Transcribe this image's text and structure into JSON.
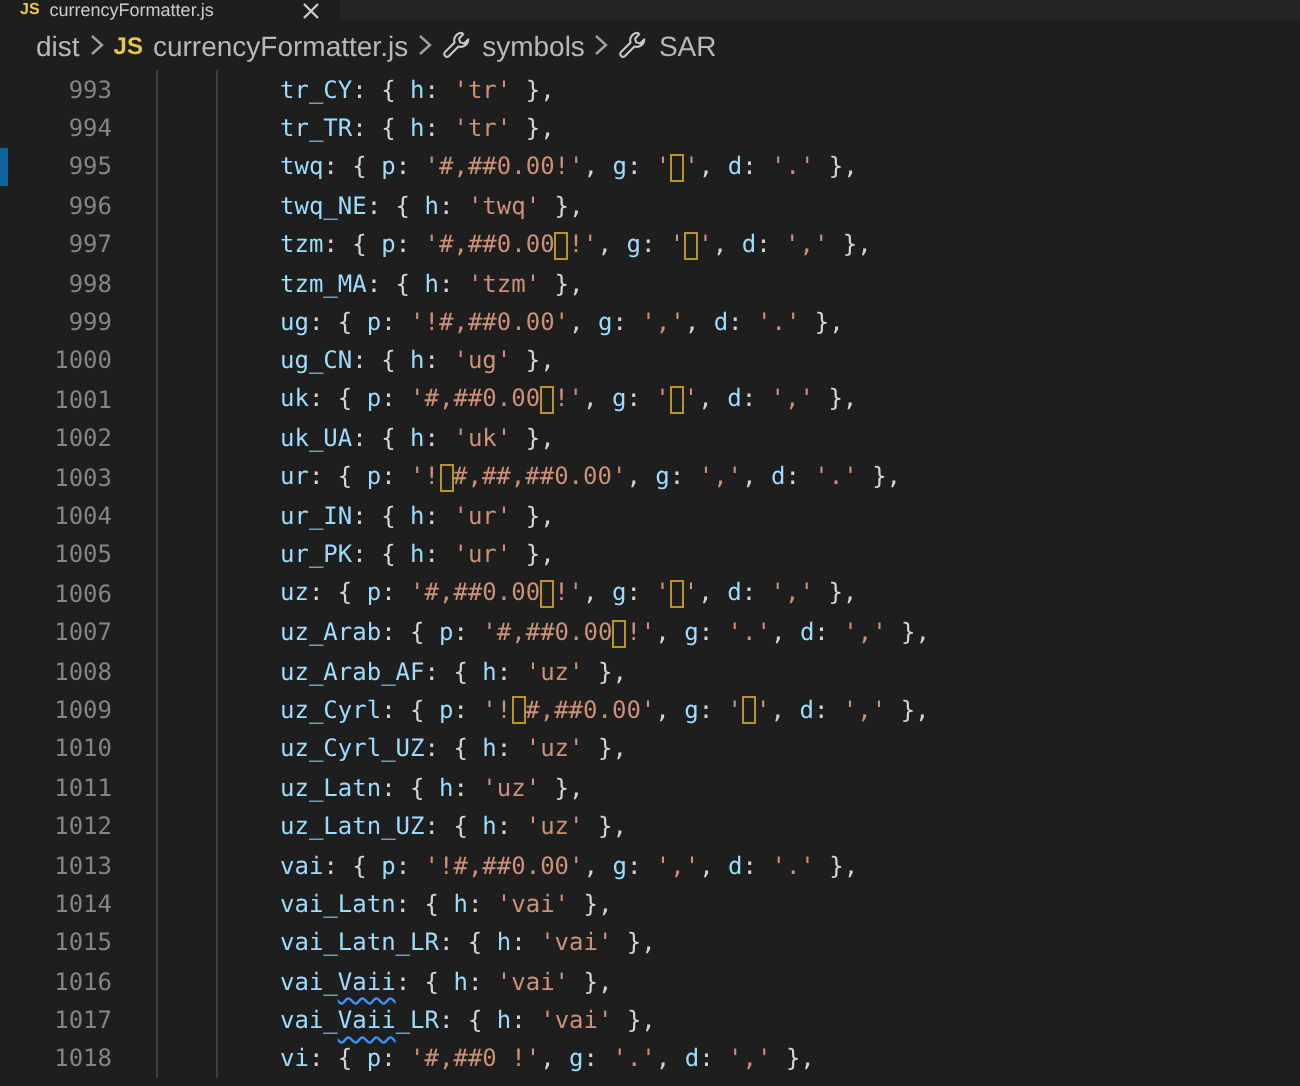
{
  "tab": {
    "badge": "JS",
    "title": "currencyFormatter.js"
  },
  "breadcrumb": [
    {
      "kind": "folder",
      "label": "dist"
    },
    {
      "kind": "file",
      "badge": "JS",
      "label": "currencyFormatter.js"
    },
    {
      "kind": "symbol",
      "label": "symbols"
    },
    {
      "kind": "symbol",
      "label": "SAR"
    }
  ],
  "lines": [
    {
      "number": "993",
      "marked": false,
      "tokens": [
        {
          "kind": "key",
          "text": "tr_CY"
        },
        {
          "kind": "punct",
          "text": ": { "
        },
        {
          "kind": "key",
          "text": "h"
        },
        {
          "kind": "punct",
          "text": ": "
        },
        {
          "kind": "str",
          "text": "'tr'"
        },
        {
          "kind": "punct",
          "text": " },"
        }
      ]
    },
    {
      "number": "994",
      "marked": false,
      "tokens": [
        {
          "kind": "key",
          "text": "tr_TR"
        },
        {
          "kind": "punct",
          "text": ": { "
        },
        {
          "kind": "key",
          "text": "h"
        },
        {
          "kind": "punct",
          "text": ": "
        },
        {
          "kind": "str",
          "text": "'tr'"
        },
        {
          "kind": "punct",
          "text": " },"
        }
      ]
    },
    {
      "number": "995",
      "marked": true,
      "tokens": [
        {
          "kind": "key",
          "text": "twq"
        },
        {
          "kind": "punct",
          "text": ": { "
        },
        {
          "kind": "key",
          "text": "p"
        },
        {
          "kind": "punct",
          "text": ": "
        },
        {
          "kind": "str",
          "text": "'#,##0.00!'"
        },
        {
          "kind": "punct",
          "text": ", "
        },
        {
          "kind": "key",
          "text": "g"
        },
        {
          "kind": "punct",
          "text": ": "
        },
        {
          "kind": "str",
          "text": "'"
        },
        {
          "kind": "box"
        },
        {
          "kind": "str",
          "text": "'"
        },
        {
          "kind": "punct",
          "text": ", "
        },
        {
          "kind": "key",
          "text": "d"
        },
        {
          "kind": "punct",
          "text": ": "
        },
        {
          "kind": "str",
          "text": "'.'"
        },
        {
          "kind": "punct",
          "text": " },"
        }
      ]
    },
    {
      "number": "996",
      "marked": false,
      "tokens": [
        {
          "kind": "key",
          "text": "twq_NE"
        },
        {
          "kind": "punct",
          "text": ": { "
        },
        {
          "kind": "key",
          "text": "h"
        },
        {
          "kind": "punct",
          "text": ": "
        },
        {
          "kind": "str",
          "text": "'twq'"
        },
        {
          "kind": "punct",
          "text": " },"
        }
      ]
    },
    {
      "number": "997",
      "marked": false,
      "tokens": [
        {
          "kind": "key",
          "text": "tzm"
        },
        {
          "kind": "punct",
          "text": ": { "
        },
        {
          "kind": "key",
          "text": "p"
        },
        {
          "kind": "punct",
          "text": ": "
        },
        {
          "kind": "str",
          "text": "'#,##0.00"
        },
        {
          "kind": "box"
        },
        {
          "kind": "str",
          "text": "!'"
        },
        {
          "kind": "punct",
          "text": ", "
        },
        {
          "kind": "key",
          "text": "g"
        },
        {
          "kind": "punct",
          "text": ": "
        },
        {
          "kind": "str",
          "text": "'"
        },
        {
          "kind": "box"
        },
        {
          "kind": "str",
          "text": "'"
        },
        {
          "kind": "punct",
          "text": ", "
        },
        {
          "kind": "key",
          "text": "d"
        },
        {
          "kind": "punct",
          "text": ": "
        },
        {
          "kind": "str",
          "text": "','"
        },
        {
          "kind": "punct",
          "text": " },"
        }
      ]
    },
    {
      "number": "998",
      "marked": false,
      "tokens": [
        {
          "kind": "key",
          "text": "tzm_MA"
        },
        {
          "kind": "punct",
          "text": ": { "
        },
        {
          "kind": "key",
          "text": "h"
        },
        {
          "kind": "punct",
          "text": ": "
        },
        {
          "kind": "str",
          "text": "'tzm'"
        },
        {
          "kind": "punct",
          "text": " },"
        }
      ]
    },
    {
      "number": "999",
      "marked": false,
      "tokens": [
        {
          "kind": "key",
          "text": "ug"
        },
        {
          "kind": "punct",
          "text": ": { "
        },
        {
          "kind": "key",
          "text": "p"
        },
        {
          "kind": "punct",
          "text": ": "
        },
        {
          "kind": "str",
          "text": "'!#,##0.00'"
        },
        {
          "kind": "punct",
          "text": ", "
        },
        {
          "kind": "key",
          "text": "g"
        },
        {
          "kind": "punct",
          "text": ": "
        },
        {
          "kind": "str",
          "text": "','"
        },
        {
          "kind": "punct",
          "text": ", "
        },
        {
          "kind": "key",
          "text": "d"
        },
        {
          "kind": "punct",
          "text": ": "
        },
        {
          "kind": "str",
          "text": "'.'"
        },
        {
          "kind": "punct",
          "text": " },"
        }
      ]
    },
    {
      "number": "1000",
      "marked": false,
      "tokens": [
        {
          "kind": "key",
          "text": "ug_CN"
        },
        {
          "kind": "punct",
          "text": ": { "
        },
        {
          "kind": "key",
          "text": "h"
        },
        {
          "kind": "punct",
          "text": ": "
        },
        {
          "kind": "str",
          "text": "'ug'"
        },
        {
          "kind": "punct",
          "text": " },"
        }
      ]
    },
    {
      "number": "1001",
      "marked": false,
      "tokens": [
        {
          "kind": "key",
          "text": "uk"
        },
        {
          "kind": "punct",
          "text": ": { "
        },
        {
          "kind": "key",
          "text": "p"
        },
        {
          "kind": "punct",
          "text": ": "
        },
        {
          "kind": "str",
          "text": "'#,##0.00"
        },
        {
          "kind": "box"
        },
        {
          "kind": "str",
          "text": "!'"
        },
        {
          "kind": "punct",
          "text": ", "
        },
        {
          "kind": "key",
          "text": "g"
        },
        {
          "kind": "punct",
          "text": ": "
        },
        {
          "kind": "str",
          "text": "'"
        },
        {
          "kind": "box"
        },
        {
          "kind": "str",
          "text": "'"
        },
        {
          "kind": "punct",
          "text": ", "
        },
        {
          "kind": "key",
          "text": "d"
        },
        {
          "kind": "punct",
          "text": ": "
        },
        {
          "kind": "str",
          "text": "','"
        },
        {
          "kind": "punct",
          "text": " },"
        }
      ]
    },
    {
      "number": "1002",
      "marked": false,
      "tokens": [
        {
          "kind": "key",
          "text": "uk_UA"
        },
        {
          "kind": "punct",
          "text": ": { "
        },
        {
          "kind": "key",
          "text": "h"
        },
        {
          "kind": "punct",
          "text": ": "
        },
        {
          "kind": "str",
          "text": "'uk'"
        },
        {
          "kind": "punct",
          "text": " },"
        }
      ]
    },
    {
      "number": "1003",
      "marked": false,
      "tokens": [
        {
          "kind": "key",
          "text": "ur"
        },
        {
          "kind": "punct",
          "text": ": { "
        },
        {
          "kind": "key",
          "text": "p"
        },
        {
          "kind": "punct",
          "text": ": "
        },
        {
          "kind": "str",
          "text": "'!"
        },
        {
          "kind": "box"
        },
        {
          "kind": "str",
          "text": "#,##,##0.00'"
        },
        {
          "kind": "punct",
          "text": ", "
        },
        {
          "kind": "key",
          "text": "g"
        },
        {
          "kind": "punct",
          "text": ": "
        },
        {
          "kind": "str",
          "text": "','"
        },
        {
          "kind": "punct",
          "text": ", "
        },
        {
          "kind": "key",
          "text": "d"
        },
        {
          "kind": "punct",
          "text": ": "
        },
        {
          "kind": "str",
          "text": "'.'"
        },
        {
          "kind": "punct",
          "text": " },"
        }
      ]
    },
    {
      "number": "1004",
      "marked": false,
      "tokens": [
        {
          "kind": "key",
          "text": "ur_IN"
        },
        {
          "kind": "punct",
          "text": ": { "
        },
        {
          "kind": "key",
          "text": "h"
        },
        {
          "kind": "punct",
          "text": ": "
        },
        {
          "kind": "str",
          "text": "'ur'"
        },
        {
          "kind": "punct",
          "text": " },"
        }
      ]
    },
    {
      "number": "1005",
      "marked": false,
      "tokens": [
        {
          "kind": "key",
          "text": "ur_PK"
        },
        {
          "kind": "punct",
          "text": ": { "
        },
        {
          "kind": "key",
          "text": "h"
        },
        {
          "kind": "punct",
          "text": ": "
        },
        {
          "kind": "str",
          "text": "'ur'"
        },
        {
          "kind": "punct",
          "text": " },"
        }
      ]
    },
    {
      "number": "1006",
      "marked": false,
      "tokens": [
        {
          "kind": "key",
          "text": "uz"
        },
        {
          "kind": "punct",
          "text": ": { "
        },
        {
          "kind": "key",
          "text": "p"
        },
        {
          "kind": "punct",
          "text": ": "
        },
        {
          "kind": "str",
          "text": "'#,##0.00"
        },
        {
          "kind": "box"
        },
        {
          "kind": "str",
          "text": "!'"
        },
        {
          "kind": "punct",
          "text": ", "
        },
        {
          "kind": "key",
          "text": "g"
        },
        {
          "kind": "punct",
          "text": ": "
        },
        {
          "kind": "str",
          "text": "'"
        },
        {
          "kind": "box"
        },
        {
          "kind": "str",
          "text": "'"
        },
        {
          "kind": "punct",
          "text": ", "
        },
        {
          "kind": "key",
          "text": "d"
        },
        {
          "kind": "punct",
          "text": ": "
        },
        {
          "kind": "str",
          "text": "','"
        },
        {
          "kind": "punct",
          "text": " },"
        }
      ]
    },
    {
      "number": "1007",
      "marked": false,
      "tokens": [
        {
          "kind": "key",
          "text": "uz_Arab"
        },
        {
          "kind": "punct",
          "text": ": { "
        },
        {
          "kind": "key",
          "text": "p"
        },
        {
          "kind": "punct",
          "text": ": "
        },
        {
          "kind": "str",
          "text": "'#,##0.00"
        },
        {
          "kind": "box"
        },
        {
          "kind": "str",
          "text": "!'"
        },
        {
          "kind": "punct",
          "text": ", "
        },
        {
          "kind": "key",
          "text": "g"
        },
        {
          "kind": "punct",
          "text": ": "
        },
        {
          "kind": "str",
          "text": "'.'"
        },
        {
          "kind": "punct",
          "text": ", "
        },
        {
          "kind": "key",
          "text": "d"
        },
        {
          "kind": "punct",
          "text": ": "
        },
        {
          "kind": "str",
          "text": "','"
        },
        {
          "kind": "punct",
          "text": " },"
        }
      ]
    },
    {
      "number": "1008",
      "marked": false,
      "tokens": [
        {
          "kind": "key",
          "text": "uz_Arab_AF"
        },
        {
          "kind": "punct",
          "text": ": { "
        },
        {
          "kind": "key",
          "text": "h"
        },
        {
          "kind": "punct",
          "text": ": "
        },
        {
          "kind": "str",
          "text": "'uz'"
        },
        {
          "kind": "punct",
          "text": " },"
        }
      ]
    },
    {
      "number": "1009",
      "marked": false,
      "tokens": [
        {
          "kind": "key",
          "text": "uz_Cyrl"
        },
        {
          "kind": "punct",
          "text": ": { "
        },
        {
          "kind": "key",
          "text": "p"
        },
        {
          "kind": "punct",
          "text": ": "
        },
        {
          "kind": "str",
          "text": "'!"
        },
        {
          "kind": "box"
        },
        {
          "kind": "str",
          "text": "#,##0.00'"
        },
        {
          "kind": "punct",
          "text": ", "
        },
        {
          "kind": "key",
          "text": "g"
        },
        {
          "kind": "punct",
          "text": ": "
        },
        {
          "kind": "str",
          "text": "'"
        },
        {
          "kind": "box"
        },
        {
          "kind": "str",
          "text": "'"
        },
        {
          "kind": "punct",
          "text": ", "
        },
        {
          "kind": "key",
          "text": "d"
        },
        {
          "kind": "punct",
          "text": ": "
        },
        {
          "kind": "str",
          "text": "','"
        },
        {
          "kind": "punct",
          "text": " },"
        }
      ]
    },
    {
      "number": "1010",
      "marked": false,
      "tokens": [
        {
          "kind": "key",
          "text": "uz_Cyrl_UZ"
        },
        {
          "kind": "punct",
          "text": ": { "
        },
        {
          "kind": "key",
          "text": "h"
        },
        {
          "kind": "punct",
          "text": ": "
        },
        {
          "kind": "str",
          "text": "'uz'"
        },
        {
          "kind": "punct",
          "text": " },"
        }
      ]
    },
    {
      "number": "1011",
      "marked": false,
      "tokens": [
        {
          "kind": "key",
          "text": "uz_Latn"
        },
        {
          "kind": "punct",
          "text": ": { "
        },
        {
          "kind": "key",
          "text": "h"
        },
        {
          "kind": "punct",
          "text": ": "
        },
        {
          "kind": "str",
          "text": "'uz'"
        },
        {
          "kind": "punct",
          "text": " },"
        }
      ]
    },
    {
      "number": "1012",
      "marked": false,
      "tokens": [
        {
          "kind": "key",
          "text": "uz_Latn_UZ"
        },
        {
          "kind": "punct",
          "text": ": { "
        },
        {
          "kind": "key",
          "text": "h"
        },
        {
          "kind": "punct",
          "text": ": "
        },
        {
          "kind": "str",
          "text": "'uz'"
        },
        {
          "kind": "punct",
          "text": " },"
        }
      ]
    },
    {
      "number": "1013",
      "marked": false,
      "tokens": [
        {
          "kind": "key",
          "text": "vai"
        },
        {
          "kind": "punct",
          "text": ": { "
        },
        {
          "kind": "key",
          "text": "p"
        },
        {
          "kind": "punct",
          "text": ": "
        },
        {
          "kind": "str",
          "text": "'!#,##0.00'"
        },
        {
          "kind": "punct",
          "text": ", "
        },
        {
          "kind": "key",
          "text": "g"
        },
        {
          "kind": "punct",
          "text": ": "
        },
        {
          "kind": "str",
          "text": "','"
        },
        {
          "kind": "punct",
          "text": ", "
        },
        {
          "kind": "key",
          "text": "d"
        },
        {
          "kind": "punct",
          "text": ": "
        },
        {
          "kind": "str",
          "text": "'.'"
        },
        {
          "kind": "punct",
          "text": " },"
        }
      ]
    },
    {
      "number": "1014",
      "marked": false,
      "tokens": [
        {
          "kind": "key",
          "text": "vai_Latn"
        },
        {
          "kind": "punct",
          "text": ": { "
        },
        {
          "kind": "key",
          "text": "h"
        },
        {
          "kind": "punct",
          "text": ": "
        },
        {
          "kind": "str",
          "text": "'vai'"
        },
        {
          "kind": "punct",
          "text": " },"
        }
      ]
    },
    {
      "number": "1015",
      "marked": false,
      "tokens": [
        {
          "kind": "key",
          "text": "vai_Latn_LR"
        },
        {
          "kind": "punct",
          "text": ": { "
        },
        {
          "kind": "key",
          "text": "h"
        },
        {
          "kind": "punct",
          "text": ": "
        },
        {
          "kind": "str",
          "text": "'vai'"
        },
        {
          "kind": "punct",
          "text": " },"
        }
      ]
    },
    {
      "number": "1016",
      "marked": false,
      "tokens": [
        {
          "kind": "key",
          "text": "vai_"
        },
        {
          "kind": "warn",
          "text": "Vaii"
        },
        {
          "kind": "punct",
          "text": ": { "
        },
        {
          "kind": "key",
          "text": "h"
        },
        {
          "kind": "punct",
          "text": ": "
        },
        {
          "kind": "str",
          "text": "'vai'"
        },
        {
          "kind": "punct",
          "text": " },"
        }
      ]
    },
    {
      "number": "1017",
      "marked": false,
      "tokens": [
        {
          "kind": "key",
          "text": "vai_"
        },
        {
          "kind": "warn",
          "text": "Vaii"
        },
        {
          "kind": "key",
          "text": "_LR"
        },
        {
          "kind": "punct",
          "text": ": { "
        },
        {
          "kind": "key",
          "text": "h"
        },
        {
          "kind": "punct",
          "text": ": "
        },
        {
          "kind": "str",
          "text": "'vai'"
        },
        {
          "kind": "punct",
          "text": " },"
        }
      ]
    },
    {
      "number": "1018",
      "marked": false,
      "tokens": [
        {
          "kind": "key",
          "text": "vi"
        },
        {
          "kind": "punct",
          "text": ": { "
        },
        {
          "kind": "key",
          "text": "p"
        },
        {
          "kind": "punct",
          "text": ": "
        },
        {
          "kind": "str",
          "text": "'#,##0 !'"
        },
        {
          "kind": "punct",
          "text": ", "
        },
        {
          "kind": "key",
          "text": "g"
        },
        {
          "kind": "punct",
          "text": ": "
        },
        {
          "kind": "str",
          "text": "'.'"
        },
        {
          "kind": "punct",
          "text": ", "
        },
        {
          "kind": "key",
          "text": "d"
        },
        {
          "kind": "punct",
          "text": ": "
        },
        {
          "kind": "str",
          "text": "','"
        },
        {
          "kind": "punct",
          "text": " },"
        }
      ]
    }
  ]
}
